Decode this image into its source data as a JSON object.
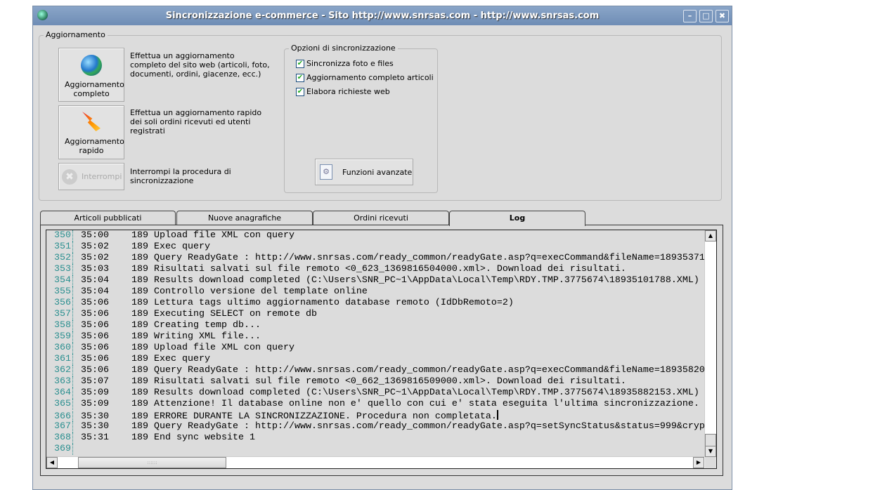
{
  "window": {
    "title": "Sincronizzazione e-commerce - Sito http://www.snrsas.com - http://www.snrsas.com",
    "minimize": "–",
    "maximize": "□",
    "close": "✖"
  },
  "update_group": {
    "label": "Aggiornamento",
    "full": {
      "label": "Aggiornamento completo",
      "desc": "Effettua un aggiornamento completo del sito web (articoli, foto, documenti, ordini, giacenze, ecc.)",
      "icon": "globe-icon"
    },
    "quick": {
      "label": "Aggiornamento rapido",
      "desc": "Effettua un aggiornamento rapido dei soli ordini ricevuti ed utenti registrati",
      "icon": "lightning-arrow-icon"
    },
    "stop": {
      "label": "Interrompi",
      "desc": "Interrompi la procedura di sincronizzazione",
      "icon": "stop-icon",
      "enabled": false
    }
  },
  "options": {
    "label": "Opzioni di sincronizzazione",
    "items": [
      {
        "label": "Sincronizza foto e files",
        "checked": true
      },
      {
        "label": "Aggiornamento completo articoli",
        "checked": true
      },
      {
        "label": "Elabora richieste web",
        "checked": true
      }
    ],
    "advanced": "Funzioni avanzate"
  },
  "tabs": [
    {
      "label": "Articoli pubblicati"
    },
    {
      "label": "Nuove anagrafiche"
    },
    {
      "label": "Ordini ricevuti"
    },
    {
      "label": "Log",
      "active": true
    }
  ],
  "log": [
    {
      "n": "350",
      "t": "35:00",
      "id": "189",
      "msg": "Upload file XML con query"
    },
    {
      "n": "351",
      "t": "35:02",
      "id": "189",
      "msg": "Exec query"
    },
    {
      "n": "352",
      "t": "35:02",
      "id": "189",
      "msg": "Query ReadyGate : http://www.snrsas.com/ready_common/readyGate.asp?q=execCommand&fileName=18935371"
    },
    {
      "n": "353",
      "t": "35:03",
      "id": "189",
      "msg": "Risultati salvati sul file remoto <0_623_1369816504000.xml>. Download dei risultati."
    },
    {
      "n": "354",
      "t": "35:04",
      "id": "189",
      "msg": "Results download completed (C:\\Users\\SNR_PC~1\\AppData\\Local\\Temp\\RDY.TMP.3775674\\18935101788.XML)"
    },
    {
      "n": "355",
      "t": "35:04",
      "id": "189",
      "msg": "Controllo versione del template online"
    },
    {
      "n": "356",
      "t": "35:06",
      "id": "189",
      "msg": "Lettura tags ultimo aggiornamento database remoto (IdDbRemoto=2)"
    },
    {
      "n": "357",
      "t": "35:06",
      "id": "189",
      "msg": "Executing SELECT on remote db"
    },
    {
      "n": "358",
      "t": "35:06",
      "id": "189",
      "msg": "Creating temp db..."
    },
    {
      "n": "359",
      "t": "35:06",
      "id": "189",
      "msg": "Writing XML file..."
    },
    {
      "n": "360",
      "t": "35:06",
      "id": "189",
      "msg": "Upload file XML con query"
    },
    {
      "n": "361",
      "t": "35:06",
      "id": "189",
      "msg": "Exec query"
    },
    {
      "n": "362",
      "t": "35:06",
      "id": "189",
      "msg": "Query ReadyGate : http://www.snrsas.com/ready_common/readyGate.asp?q=execCommand&fileName=18935820"
    },
    {
      "n": "363",
      "t": "35:07",
      "id": "189",
      "msg": "Risultati salvati sul file remoto <0_662_1369816509000.xml>. Download dei risultati."
    },
    {
      "n": "364",
      "t": "35:09",
      "id": "189",
      "msg": "Results download completed (C:\\Users\\SNR_PC~1\\AppData\\Local\\Temp\\RDY.TMP.3775674\\18935882153.XML)"
    },
    {
      "n": "365",
      "t": "35:09",
      "id": "189",
      "msg": "Attenzione! Il database online non e' quello con cui e' stata eseguita l'ultima sincronizzazione."
    },
    {
      "n": "366",
      "t": "35:30",
      "id": "189",
      "msg": "ERRORE DURANTE LA SINCRONIZZAZIONE. Procedura non completata.",
      "cursor": true
    },
    {
      "n": "367",
      "t": "35:30",
      "id": "189",
      "msg": "Query ReadyGate : http://www.snrsas.com/ready_common/readyGate.asp?q=setSyncStatus&status=999&cryp"
    },
    {
      "n": "368",
      "t": "35:31",
      "id": "189",
      "msg": "End sync website 1"
    },
    {
      "n": "369",
      "t": "",
      "id": "",
      "msg": ""
    }
  ]
}
